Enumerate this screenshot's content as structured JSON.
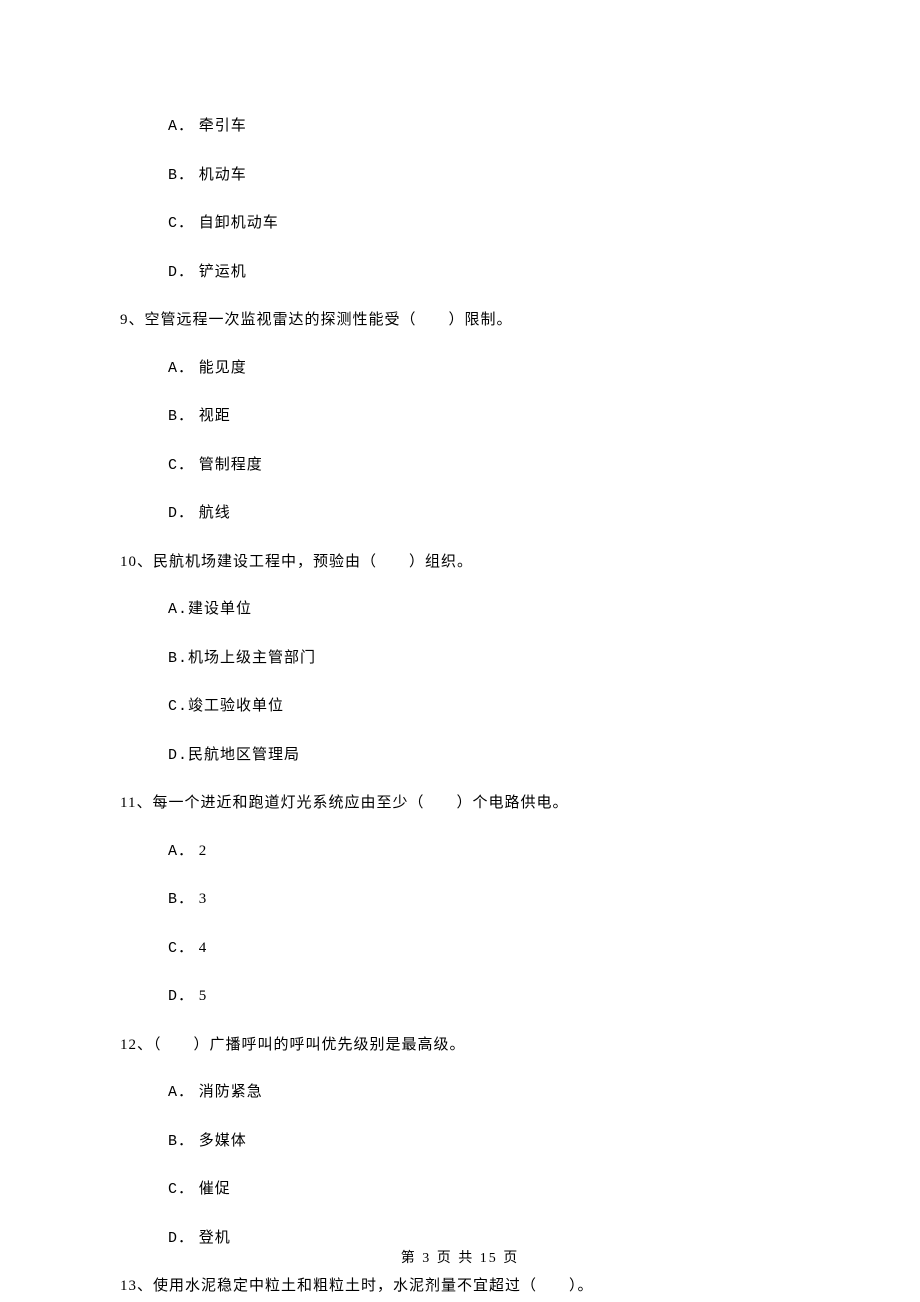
{
  "options_pre": [
    {
      "letter": "A．",
      "text": "牵引车"
    },
    {
      "letter": "B．",
      "text": "机动车"
    },
    {
      "letter": "C．",
      "text": "自卸机动车"
    },
    {
      "letter": "D．",
      "text": "铲运机"
    }
  ],
  "q9": {
    "stem": "9、空管远程一次监视雷达的探测性能受（　　）限制。",
    "options": [
      {
        "letter": "A．",
        "text": "能见度"
      },
      {
        "letter": "B．",
        "text": "视距"
      },
      {
        "letter": "C．",
        "text": "管制程度"
      },
      {
        "letter": "D．",
        "text": "航线"
      }
    ]
  },
  "q10": {
    "stem": "10、民航机场建设工程中，预验由（　　）组织。",
    "options": [
      {
        "letter": "A.",
        "text": "建设单位"
      },
      {
        "letter": "B.",
        "text": "机场上级主管部门"
      },
      {
        "letter": "C.",
        "text": "竣工验收单位"
      },
      {
        "letter": "D.",
        "text": "民航地区管理局"
      }
    ]
  },
  "q11": {
    "stem": "11、每一个进近和跑道灯光系统应由至少（　　）个电路供电。",
    "options": [
      {
        "letter": "A．",
        "text": "2"
      },
      {
        "letter": "B．",
        "text": "3"
      },
      {
        "letter": "C．",
        "text": "4"
      },
      {
        "letter": "D．",
        "text": "5"
      }
    ]
  },
  "q12": {
    "stem": "12、（　　）广播呼叫的呼叫优先级别是最高级。",
    "options": [
      {
        "letter": "A．",
        "text": "消防紧急"
      },
      {
        "letter": "B．",
        "text": "多媒体"
      },
      {
        "letter": "C．",
        "text": "催促"
      },
      {
        "letter": "D．",
        "text": "登机"
      }
    ]
  },
  "q13": {
    "stem": "13、使用水泥稳定中粒土和粗粒土时，水泥剂量不宜超过（　　）。"
  },
  "footer": "第 3 页 共 15 页"
}
